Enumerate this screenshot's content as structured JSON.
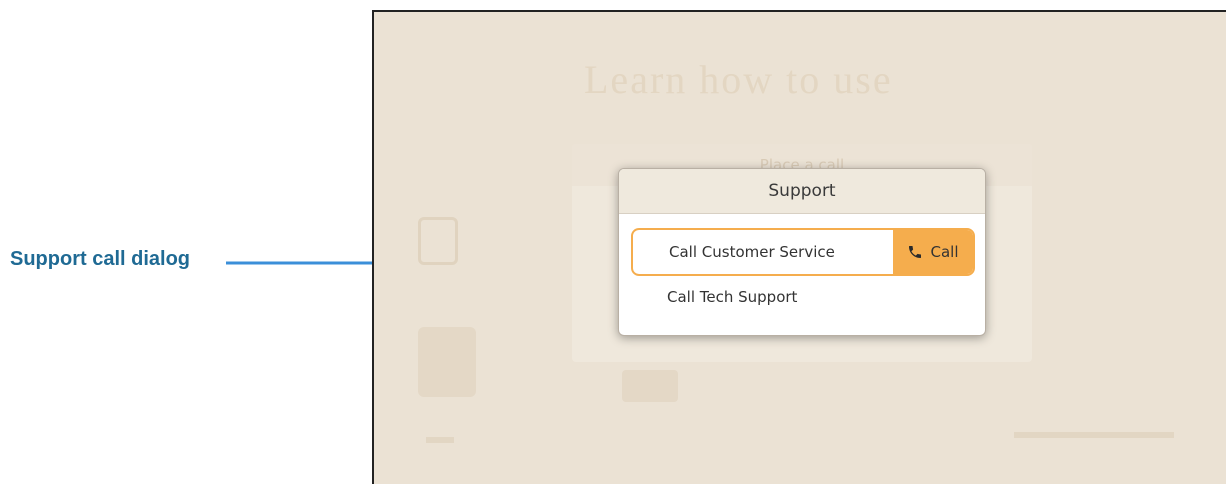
{
  "annotation": {
    "label": "Support call dialog",
    "color": "#1f6a94"
  },
  "background": {
    "title": "Learn how to use",
    "panel_header": "Place a call"
  },
  "dialog": {
    "title": "Support",
    "items": [
      {
        "label": "Call Customer Service",
        "selected": true,
        "action_label": "Call",
        "action_icon": "phone-icon"
      },
      {
        "label": "Call Tech Support",
        "selected": false
      }
    ],
    "accent_color": "#f5ad4d"
  }
}
